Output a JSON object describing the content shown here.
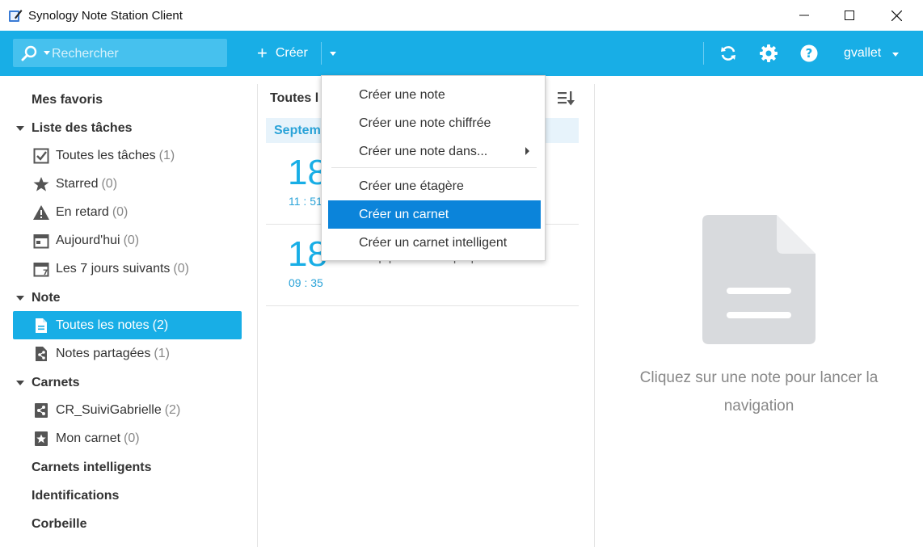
{
  "window": {
    "title": "Synology Note Station Client"
  },
  "toolbar": {
    "search_placeholder": "Rechercher",
    "create_label": "Créer",
    "user_label": "gvallet",
    "accent": "#18aee6"
  },
  "sidebar": {
    "favorites": "Mes favoris",
    "tasks_header": "Liste des tâches",
    "task_items": [
      {
        "label": "Toutes les tâches",
        "count": "(1)",
        "icon": "checkbox-icon"
      },
      {
        "label": "Starred",
        "count": "(0)",
        "icon": "star-icon"
      },
      {
        "label": "En retard",
        "count": "(0)",
        "icon": "warning-icon"
      },
      {
        "label": "Aujourd'hui",
        "count": "(0)",
        "icon": "calendar-today-icon"
      },
      {
        "label": "Les 7 jours suivants",
        "count": "(0)",
        "icon": "calendar-week-icon"
      }
    ],
    "note_header": "Note",
    "note_items": [
      {
        "label": "Toutes les notes",
        "count": "(2)",
        "icon": "notes-icon",
        "active": true
      },
      {
        "label": "Notes partagées",
        "count": "(1)",
        "icon": "shared-notes-icon"
      }
    ],
    "notebooks_header": "Carnets",
    "notebook_items": [
      {
        "label": "CR_SuiviGabrielle",
        "count": "(2)",
        "icon": "shared-notebook-icon"
      },
      {
        "label": "Mon carnet",
        "count": "(0)",
        "icon": "notebook-star-icon"
      }
    ],
    "smart_notebooks": "Carnets intelligents",
    "tags": "Identifications",
    "trash": "Corbeille"
  },
  "note_list": {
    "header": "Toutes l",
    "group": "Septem",
    "notes": [
      {
        "day": "18",
        "time": "11 : 51",
        "title": ""
      },
      {
        "day": "18",
        "time": "09 : 35",
        "title": "Prep plan - Bank pdq"
      }
    ]
  },
  "create_menu": {
    "items": [
      {
        "label": "Créer une note"
      },
      {
        "label": "Créer une note chiffrée"
      },
      {
        "label": "Créer une note dans..."
      },
      {
        "label": "Créer une étagère"
      },
      {
        "label": "Créer un carnet"
      },
      {
        "label": "Créer un carnet intelligent"
      }
    ]
  },
  "preview": {
    "empty_line1": "Cliquez sur une note pour lancer la",
    "empty_line2": "navigation"
  }
}
